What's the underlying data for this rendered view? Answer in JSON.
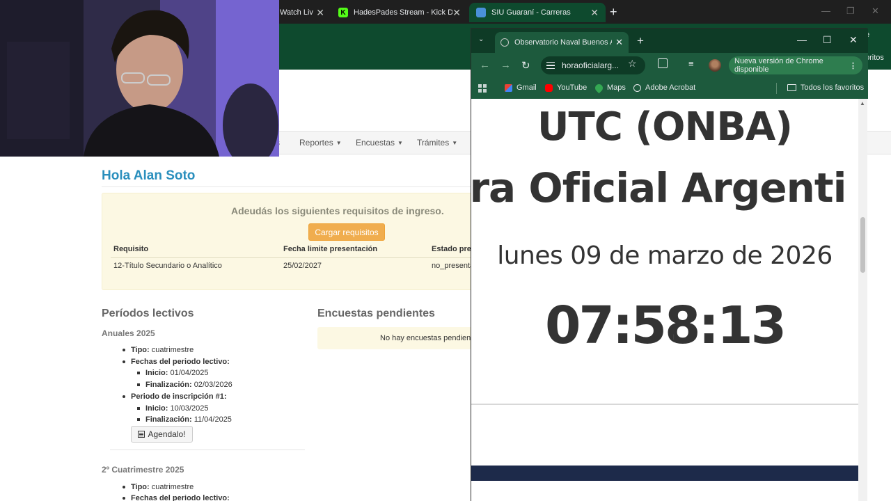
{
  "bg_browser": {
    "tabs": [
      {
        "label": "Watch Liv",
        "favicon": "live-icon"
      },
      {
        "label": "HadesPades Stream - Kick Dash",
        "favicon": "kick-icon"
      },
      {
        "label": "SIU Guaraní - Carreras",
        "favicon": "siu-icon"
      }
    ],
    "new_tab": "+",
    "fav_fragment": "oritos"
  },
  "siu": {
    "nav": [
      {
        "label": "s"
      },
      {
        "label": "Reportes"
      },
      {
        "label": "Encuestas"
      },
      {
        "label": "Trámites"
      }
    ],
    "greeting": "Hola Alan Soto",
    "requisitos": {
      "title": "Adeudás los siguientes requisitos de ingreso.",
      "button": "Cargar requisitos",
      "headers": [
        "Requisito",
        "Fecha limite presentación",
        "Estado pre"
      ],
      "row": [
        "12-Título Secundario o Analítico",
        "25/02/2027",
        "no_presenta"
      ]
    },
    "periodos": {
      "title": "Períodos lectivos",
      "anuales": {
        "title": "Anuales 2025",
        "tipo_label": "Tipo:",
        "tipo_value": "cuatrimestre",
        "fechas_label": "Fechas del periodo lectivo:",
        "inicio_label": "Inicio:",
        "inicio_value": "01/04/2025",
        "fin_label": "Finalización:",
        "fin_value": "02/03/2026",
        "insc_label": "Periodo de inscripción #1:",
        "insc_inicio_label": "Inicio:",
        "insc_inicio_value": "10/03/2025",
        "insc_fin_label": "Finalización:",
        "insc_fin_value": "11/04/2025",
        "agendalo": "Agendalo!"
      },
      "segundo": {
        "title": "2º Cuatrimestre 2025",
        "tipo_label": "Tipo:",
        "tipo_value": "cuatrimestre",
        "fechas_label": "Fechas del periodo lectivo:"
      }
    },
    "encuestas": {
      "title": "Encuestas pendientes",
      "empty": "No hay encuestas pendient"
    }
  },
  "popup": {
    "tab_title": "Observatorio Naval Buenos Aire",
    "address": "horaoficialarg...",
    "update_label": "Nueva versión de Chrome disponible",
    "bookmarks": [
      {
        "label": "Gmail",
        "icon": "gmail-icon"
      },
      {
        "label": "YouTube",
        "icon": "youtube-icon"
      },
      {
        "label": "Maps",
        "icon": "maps-icon"
      },
      {
        "label": "Adobe Acrobat",
        "icon": "acrobat-icon"
      }
    ],
    "all_bookmarks": "Todos los favoritos",
    "content": {
      "line1": "UTC (ONBA)",
      "line2": "ra Oficial Argenti",
      "date": "lunes 09 de marzo de 2026",
      "time": "07:58:13"
    }
  },
  "colors": {
    "chrome_green": "#1d5a3d",
    "siu_link": "#2a8fbd",
    "warning_bg": "#fcf8e3",
    "warning_button": "#f0ad4e",
    "footer_navy": "#1d2a4a"
  }
}
